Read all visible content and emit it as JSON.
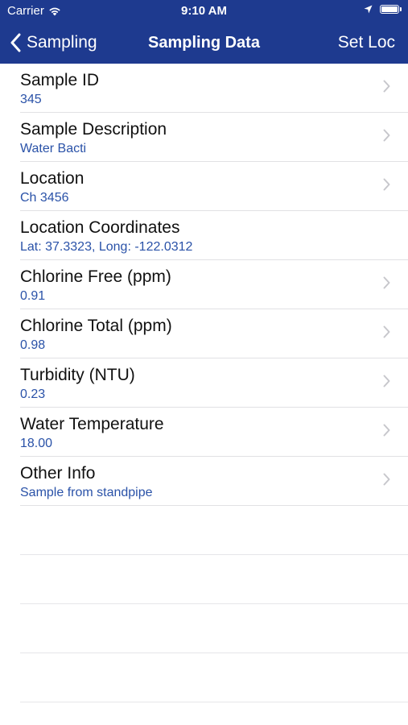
{
  "status_bar": {
    "carrier": "Carrier",
    "time": "9:10 AM"
  },
  "navbar": {
    "back_label": "Sampling",
    "title": "Sampling Data",
    "right_label": "Set Loc"
  },
  "rows": [
    {
      "title": "Sample ID",
      "value": "345"
    },
    {
      "title": "Sample Description",
      "value": "Water Bacti"
    },
    {
      "title": "Location",
      "value": "Ch 3456"
    },
    {
      "title": "Location Coordinates",
      "value": "Lat: 37.3323, Long: -122.0312"
    },
    {
      "title": "Chlorine Free (ppm)",
      "value": "0.91"
    },
    {
      "title": "Chlorine Total (ppm)",
      "value": "0.98"
    },
    {
      "title": "Turbidity (NTU)",
      "value": "0.23"
    },
    {
      "title": "Water Temperature",
      "value": "18.00"
    },
    {
      "title": "Other Info",
      "value": "Sample from standpipe"
    }
  ],
  "colors": {
    "nav_background": "#1e3a8f",
    "value_text": "#2a52a8",
    "separator": "#e1e1e4",
    "chevron": "#c7c7cc"
  },
  "icons": {
    "wifi": "wifi-icon",
    "location": "location-arrow-icon",
    "battery": "battery-icon",
    "back": "chevron-left-icon",
    "disclosure": "chevron-right-icon"
  }
}
